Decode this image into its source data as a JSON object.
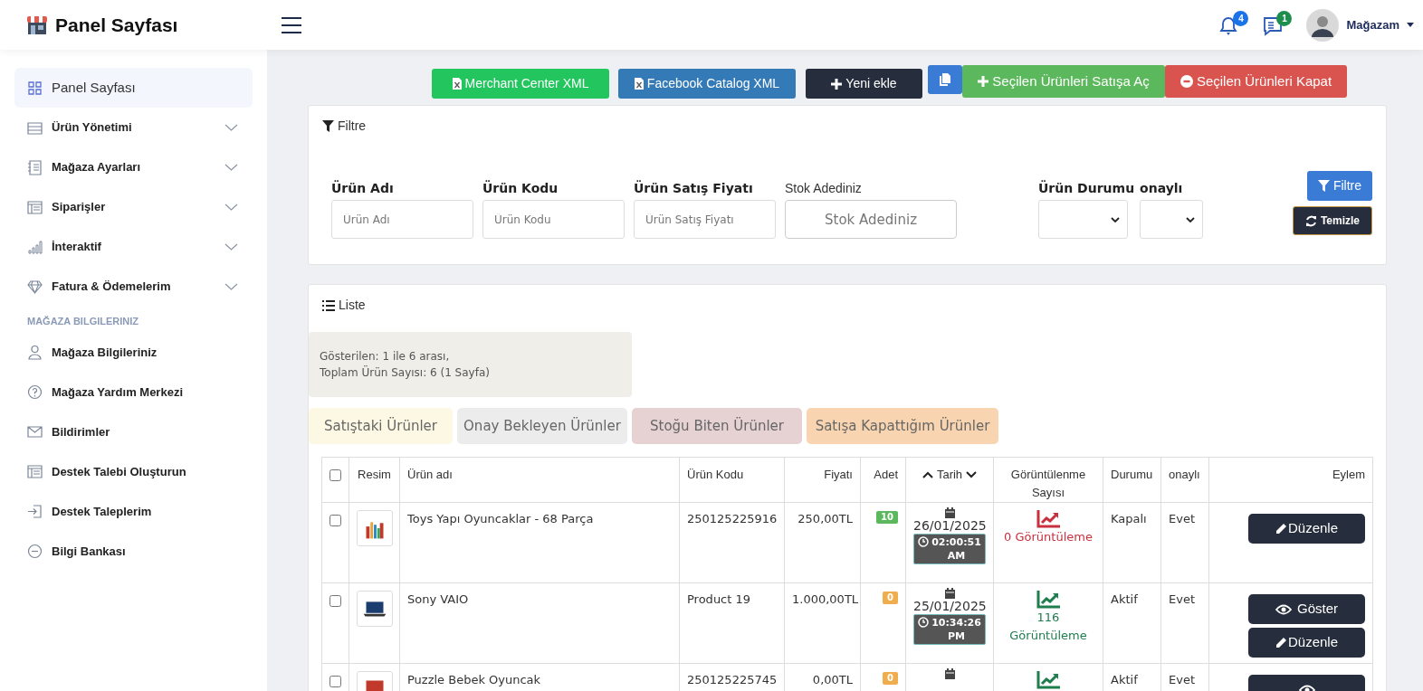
{
  "header": {
    "title": "Panel Sayfası",
    "notifications": "4",
    "messages": "1",
    "user": "Mağazam"
  },
  "sidebar": {
    "items": [
      {
        "label": "Panel Sayfası",
        "kind": "grid",
        "expandable": false,
        "selected": true
      },
      {
        "label": "Ürün Yönetimi",
        "kind": "server",
        "expandable": true,
        "selected": false
      },
      {
        "label": "Mağaza Ayarları",
        "kind": "list",
        "expandable": true,
        "selected": false
      },
      {
        "label": "Siparişler",
        "kind": "table",
        "expandable": true,
        "selected": false
      },
      {
        "label": "İnteraktif",
        "kind": "bars",
        "expandable": true,
        "selected": false
      },
      {
        "label": "Fatura & Ödemelerim",
        "kind": "diamond",
        "expandable": true,
        "selected": false
      }
    ],
    "section": "MAĞAZA BILGILERINIZ",
    "section_items": [
      {
        "label": "Mağaza Bilgileriniz",
        "kind": "user",
        "selected": false
      },
      {
        "label": "Mağaza Yardım Merkezi",
        "kind": "help",
        "selected": false
      },
      {
        "label": "Bildirimler",
        "kind": "mail",
        "selected": false
      },
      {
        "label": "Destek Talebi Oluşturun",
        "kind": "table",
        "selected": false
      },
      {
        "label": "Destek Taleplerim",
        "kind": "enter",
        "selected": false
      },
      {
        "label": "Bilgi Bankası",
        "kind": "minus",
        "selected": false
      }
    ]
  },
  "toolbar": [
    {
      "kind": "merchant",
      "label": "Merchant Center XML"
    },
    {
      "kind": "facebook",
      "label": "Facebook Catalog XML"
    },
    {
      "kind": "add",
      "label": "Yeni ekle"
    },
    {
      "kind": "copy"
    },
    {
      "kind": "open",
      "label": "Seçilen Ürünleri Satışa Aç"
    },
    {
      "kind": "close",
      "label": "Seçilen Ürünleri Kapat"
    }
  ],
  "filter": {
    "title": "Filtre",
    "fields": [
      {
        "kind": "text",
        "label": "Ürün Adı",
        "placeholder": "Ürün Adı"
      },
      {
        "kind": "text",
        "label": "Ürün Kodu",
        "placeholder": "Ürün Kodu"
      },
      {
        "kind": "text",
        "label": "Ürün Satış Fiyatı",
        "placeholder": "Ürün Satış Fiyatı"
      },
      {
        "kind": "wide",
        "label": "Stok Adediniz",
        "placeholder": "Stok Adediniz"
      },
      {
        "kind": "select",
        "label": "Ürün Durumu"
      },
      {
        "kind": "small-select",
        "label": "onaylı"
      }
    ],
    "filter_button": "Filtre",
    "clear_button": "Temizle"
  },
  "list": {
    "title": "Liste",
    "summary": [
      "Gösterilen: 1 ile 6 arası,",
      "Toplam Ürün Sayısı: 6 (1 Sayfa)"
    ],
    "tabs": [
      {
        "label": "Satıştaki Ürünler",
        "color": "#fcf8e3"
      },
      {
        "label": "Onay Bekleyen Ürünler",
        "color": "#ececec"
      },
      {
        "label": "Stoğu Biten Ürünler",
        "color": "#e6d2d3"
      },
      {
        "label": "Satışa Kapattığım Ürünler",
        "color": "#f8d5b0"
      }
    ],
    "table": {
      "all_checked": false,
      "columns": [
        "Resim",
        "Ürün adı",
        "Ürün Kodu",
        "Fiyatı",
        "Adet",
        "Tarih",
        "Görüntülenme Sayısı",
        "Durumu",
        "onaylı",
        "Eylem"
      ],
      "rows": [
        {
          "checked": false,
          "name": "Toys Yapı Oyuncaklar - 68 Parça",
          "code": "250125225916",
          "price": "250,00TL",
          "stock": {
            "text": "10",
            "color": "#5cb85c"
          },
          "date": "26/01/2025",
          "time": "02:00:51 AM",
          "views": {
            "text": "0 Görüntüleme",
            "color": "#c9303e"
          },
          "status": "Kapalı",
          "approved": "Evet",
          "actions": [
            {
              "kind": "edit",
              "label": "Düzenle"
            }
          ]
        },
        {
          "checked": false,
          "name": "Sony VAIO",
          "code": "Product 19",
          "price": "1.000,00TL",
          "stock": {
            "text": "0",
            "color": "#f0ad4e"
          },
          "date": "25/01/2025",
          "time": "10:34:26 PM",
          "views": {
            "text": "116 Görüntüleme",
            "color": "#1e7e4e"
          },
          "status": "Aktif",
          "approved": "Evet",
          "actions": [
            {
              "kind": "view",
              "label": "Göster"
            },
            {
              "kind": "edit",
              "label": "Düzenle"
            }
          ]
        },
        {
          "checked": false,
          "name": "Puzzle Bebek Oyuncak",
          "code": "250125225745",
          "price": "0,00TL",
          "stock": {
            "text": "0",
            "color": "#f0ad4e"
          },
          "views": {
            "color": "#1e7e4e"
          },
          "status": "Aktif",
          "approved": "Evet",
          "actions": [
            {
              "kind": "view"
            }
          ]
        }
      ]
    }
  }
}
